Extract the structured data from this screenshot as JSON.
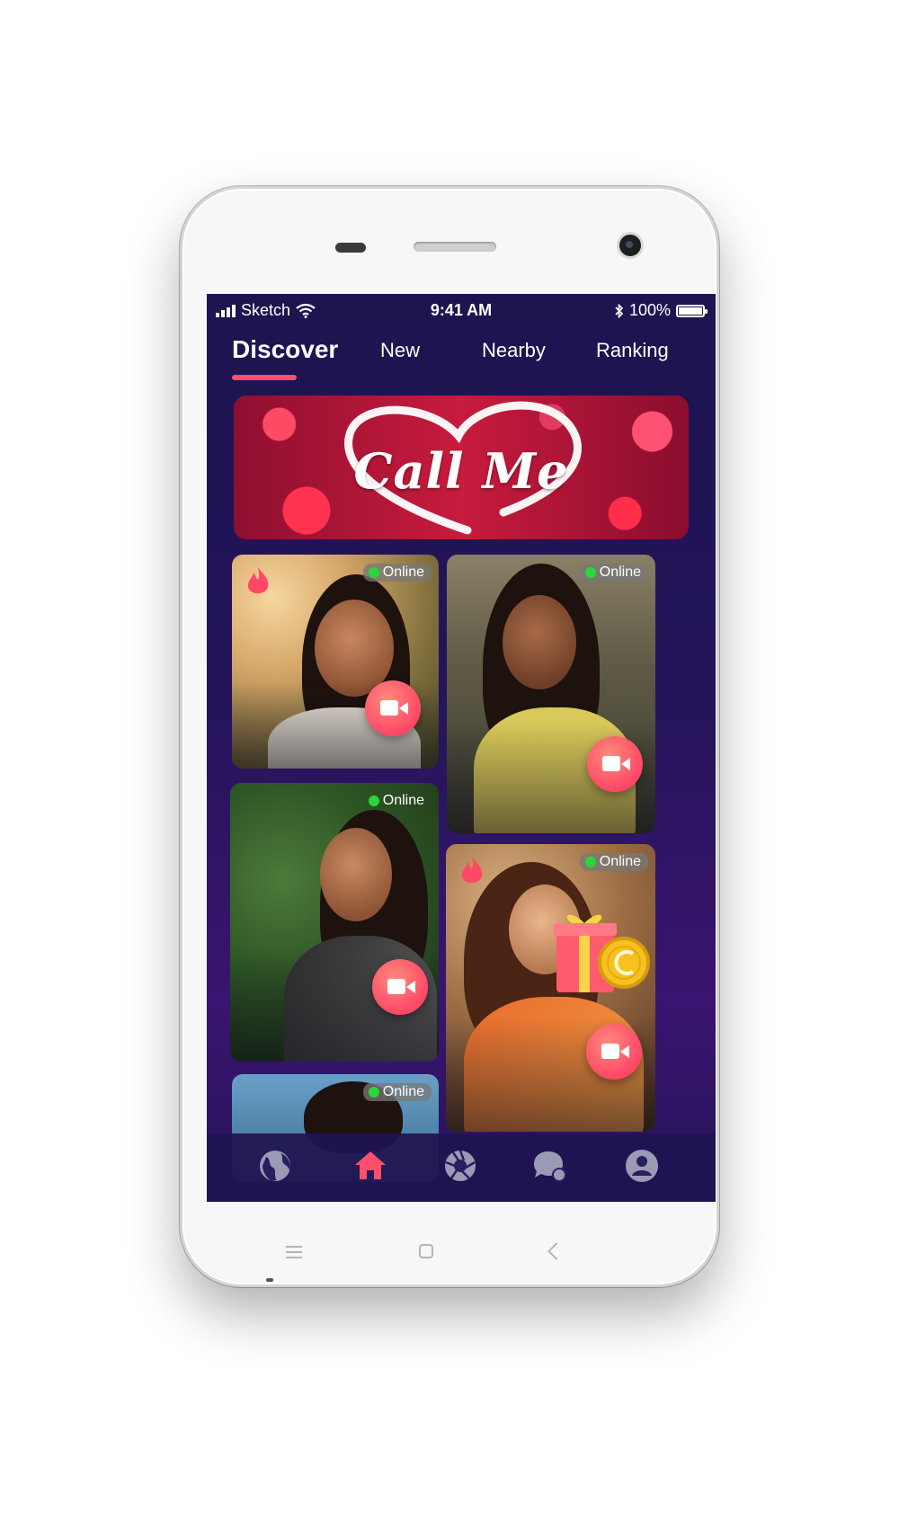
{
  "status_bar": {
    "carrier": "Sketch",
    "time": "9:41 AM",
    "battery": "100%",
    "icons": [
      "signal-icon",
      "wifi-icon",
      "bluetooth-icon",
      "battery-icon"
    ]
  },
  "tabs": [
    {
      "label": "Discover",
      "active": true
    },
    {
      "label": "New",
      "active": false
    },
    {
      "label": "Nearby",
      "active": false
    },
    {
      "label": "Ranking",
      "active": false
    }
  ],
  "banner": {
    "text": "Call Me"
  },
  "cards": [
    {
      "status": "Online",
      "hot": true,
      "gift": false
    },
    {
      "status": "Online",
      "hot": false,
      "gift": false
    },
    {
      "status": "Online",
      "hot": false,
      "gift": false
    },
    {
      "status": "Online",
      "hot": true,
      "gift": true
    },
    {
      "status": "Online",
      "hot": false,
      "gift": false
    }
  ],
  "bottom_nav": [
    {
      "icon": "globe-icon",
      "active": false
    },
    {
      "icon": "home-icon",
      "active": true
    },
    {
      "icon": "aperture-icon",
      "active": false
    },
    {
      "icon": "chat-icon",
      "active": false
    },
    {
      "icon": "profile-icon",
      "active": false
    }
  ],
  "colors": {
    "accent": "#ff4f6d",
    "background": "#1d1450",
    "online": "#2bd63a",
    "nav_inactive": "#9a9ab5"
  }
}
